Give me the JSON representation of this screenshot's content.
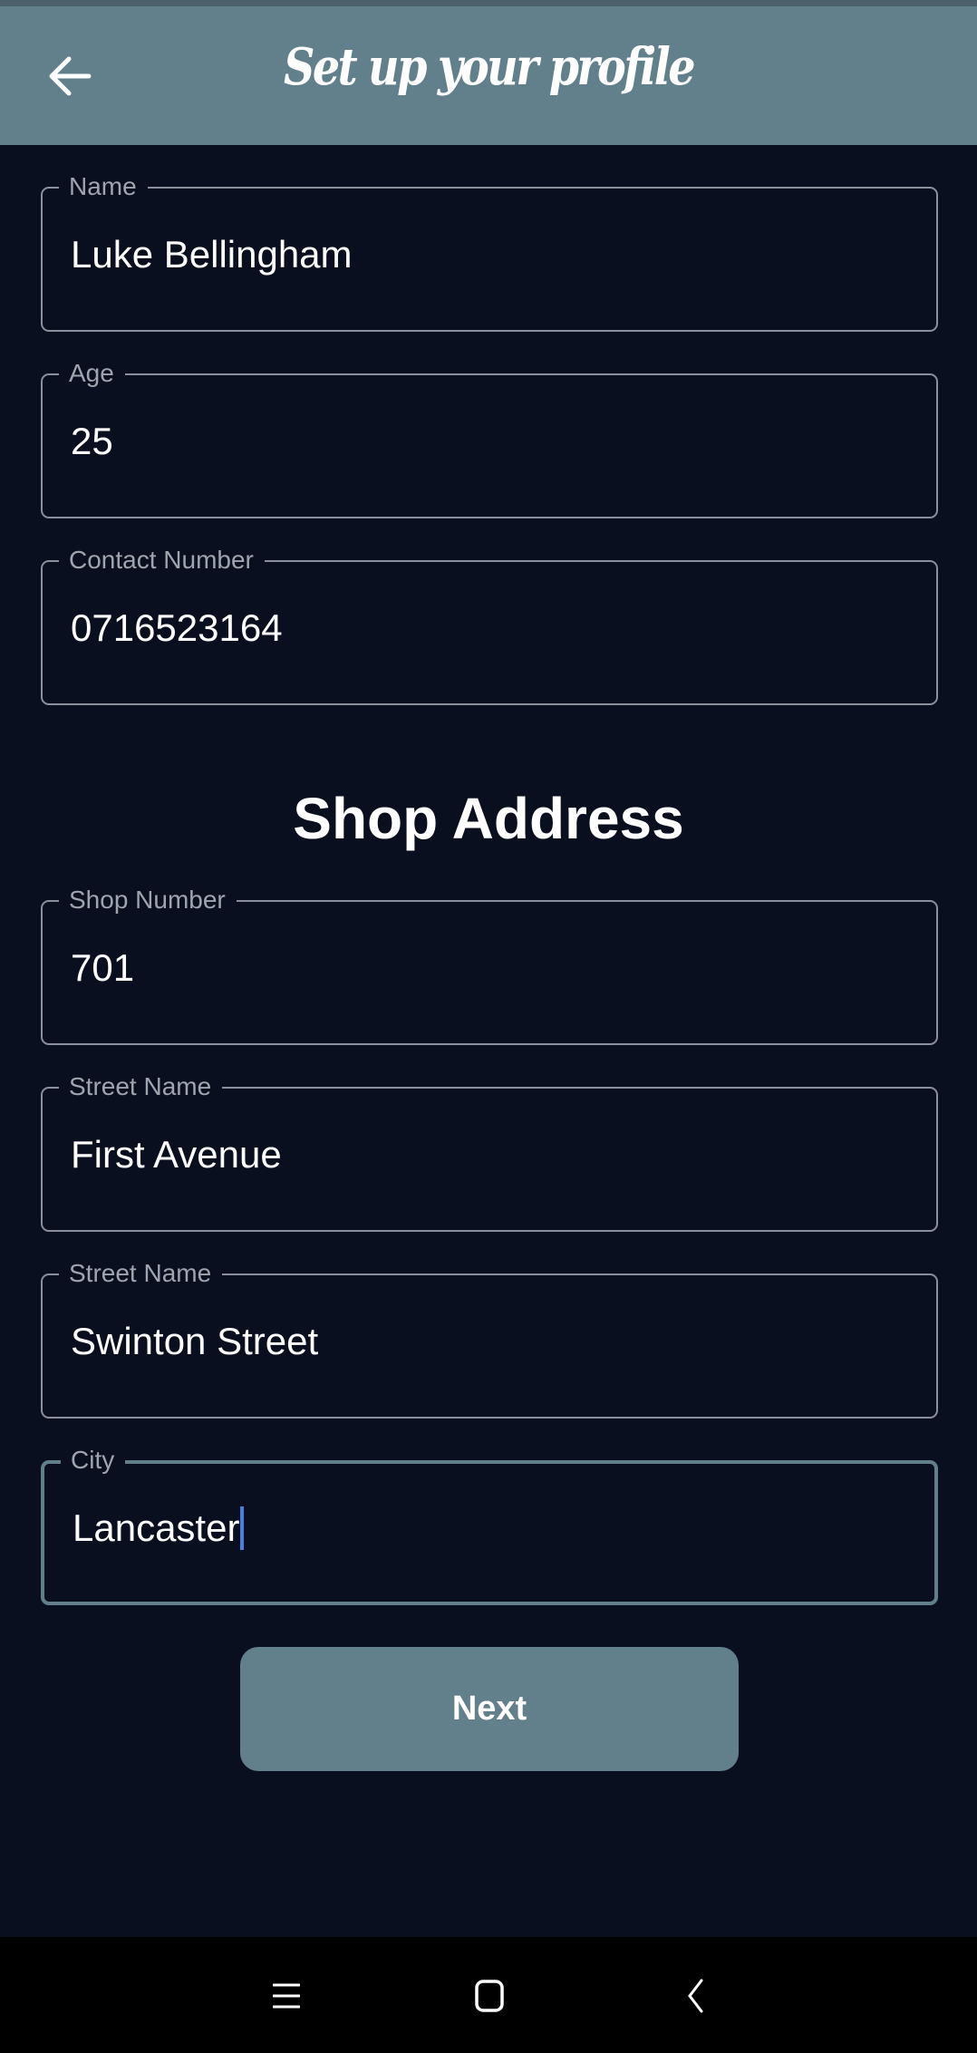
{
  "header": {
    "title": "Set up your profile"
  },
  "fields": [
    {
      "label": "Name",
      "value": "Luke Bellingham"
    },
    {
      "label": "Age",
      "value": "25"
    },
    {
      "label": "Contact Number",
      "value": "0716523164"
    }
  ],
  "shop_section": {
    "title": "Shop Address"
  },
  "shop_fields": [
    {
      "label": "Shop Number",
      "value": "701"
    },
    {
      "label": "Street Name",
      "value": "First Avenue"
    },
    {
      "label": "Street Name",
      "value": "Swinton Street"
    },
    {
      "label": "City",
      "value": "Lancaster"
    }
  ],
  "next_button": {
    "label": "Next"
  },
  "colors": {
    "accent": "#62808c",
    "background": "#0a0f20",
    "caret": "#4a7fe0"
  }
}
